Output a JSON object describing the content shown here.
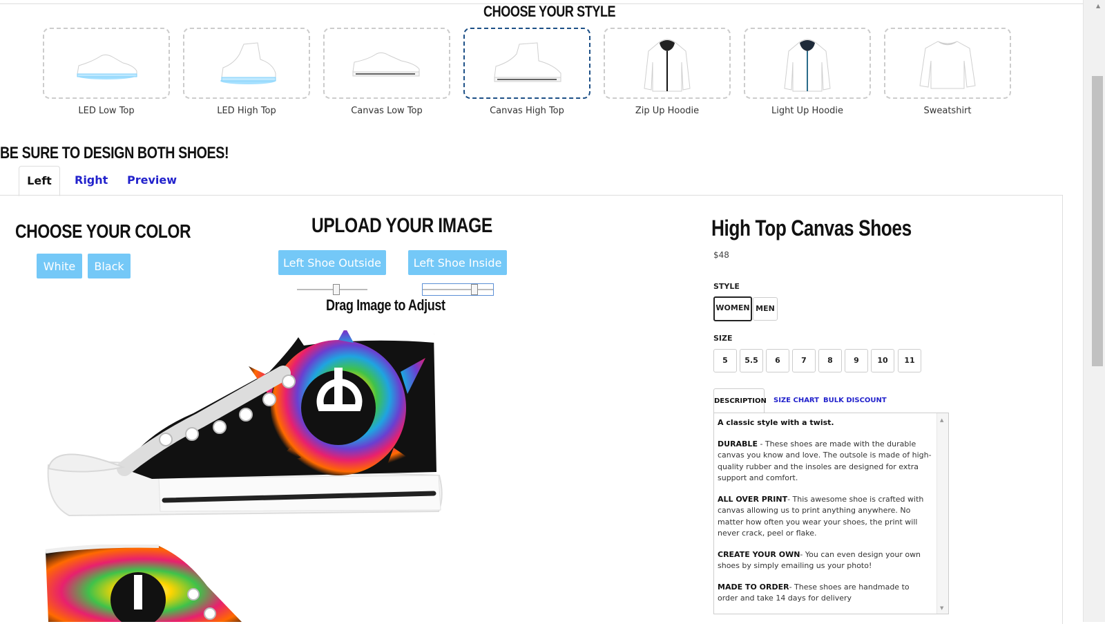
{
  "styles": {
    "title": "CHOOSE YOUR STYLE",
    "items": [
      {
        "label": "LED Low Top",
        "icon": "led-low-top-shoe-icon",
        "selected": false
      },
      {
        "label": "LED High Top",
        "icon": "led-high-top-shoe-icon",
        "selected": false
      },
      {
        "label": "Canvas Low Top",
        "icon": "canvas-low-top-shoe-icon",
        "selected": false
      },
      {
        "label": "Canvas High Top",
        "icon": "canvas-high-top-shoe-icon",
        "selected": true
      },
      {
        "label": "Zip Up Hoodie",
        "icon": "zip-hoodie-icon",
        "selected": false
      },
      {
        "label": "Light Up Hoodie",
        "icon": "light-hoodie-icon",
        "selected": false
      },
      {
        "label": "Sweatshirt",
        "icon": "sweatshirt-icon",
        "selected": false
      }
    ]
  },
  "design": {
    "title": "BE SURE TO DESIGN BOTH SHOES!",
    "tabs": [
      {
        "label": "Left",
        "active": true
      },
      {
        "label": "Right",
        "active": false
      },
      {
        "label": "Preview",
        "active": false
      }
    ]
  },
  "color": {
    "title": "CHOOSE YOUR COLOR",
    "options": [
      "White",
      "Black"
    ]
  },
  "upload": {
    "title": "UPLOAD YOUR IMAGE",
    "buttons": [
      "Left Shoe Outside",
      "Left Shoe Inside"
    ],
    "drag_label": "Drag Image to Adjust"
  },
  "product": {
    "title": "High Top Canvas Shoes",
    "price": "$48",
    "style_label": "STYLE",
    "styles": [
      "WOMEN",
      "MEN"
    ],
    "selected_style": "WOMEN",
    "size_label": "SIZE",
    "sizes": [
      "5",
      "5.5",
      "6",
      "7",
      "8",
      "9",
      "10",
      "11"
    ],
    "tabs": [
      "DESCRIPTION",
      "SIZE CHART",
      "BULK DISCOUNT"
    ],
    "description": {
      "intro": "A classic style with a twist.",
      "sections": [
        {
          "heading": "DURABLE",
          "text": " - These shoes are made with the durable canvas you know and love. The outsole is made of high-quality rubber and the insoles are designed for extra support and comfort."
        },
        {
          "heading": "ALL OVER PRINT",
          "text": "- This awesome shoe is crafted with canvas allowing us to print anything anywhere. No matter how often you wear your shoes, the print will never crack, peel or flake."
        },
        {
          "heading": "CREATE YOUR OWN",
          "text": "- You can even design your own shoes by simply emailing us your photo!"
        },
        {
          "heading": "MADE TO ORDER",
          "text": "- These shoes are handmade to order and take 14 days for delivery"
        }
      ]
    }
  },
  "colors": {
    "accent_button": "#74c8f7",
    "link": "#2222cc",
    "selected_border": "#1c4f86"
  }
}
